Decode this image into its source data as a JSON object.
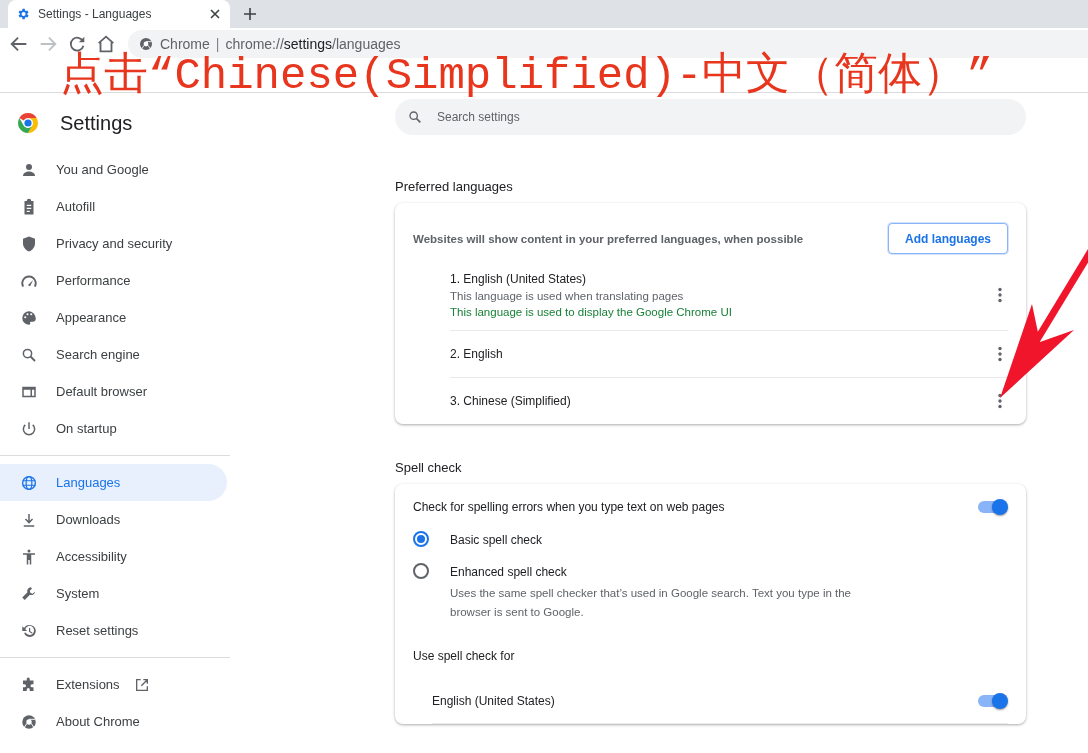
{
  "browser": {
    "tab": {
      "title": "Settings - Languages",
      "selected": true
    },
    "toolbar": {
      "forward_disabled": true,
      "site_label": "Chrome",
      "separator": "|",
      "url": {
        "scheme": "chrome://",
        "host": "settings",
        "path": "/languages"
      }
    }
  },
  "annotation": {
    "text": "点击“Chinese(Simplified)-中文（简体）”"
  },
  "header": {
    "title": "Settings",
    "search": {
      "placeholder": "Search settings"
    }
  },
  "sidebar": {
    "groups": [
      [
        {
          "label": "You and Google",
          "selected": false
        },
        {
          "label": "Autofill",
          "selected": false
        },
        {
          "label": "Privacy and security",
          "selected": false
        },
        {
          "label": "Performance",
          "selected": false
        },
        {
          "label": "Appearance",
          "selected": false
        },
        {
          "label": "Search engine",
          "selected": false
        },
        {
          "label": "Default browser",
          "selected": false
        },
        {
          "label": "On startup",
          "selected": false
        }
      ],
      [
        {
          "label": "Languages",
          "selected": true
        },
        {
          "label": "Downloads",
          "selected": false
        },
        {
          "label": "Accessibility",
          "selected": false
        },
        {
          "label": "System",
          "selected": false
        },
        {
          "label": "Reset settings",
          "selected": false
        }
      ],
      [
        {
          "label": "Extensions",
          "selected": false,
          "external": true
        },
        {
          "label": "About Chrome",
          "selected": false
        }
      ]
    ]
  },
  "preferred_languages": {
    "heading": "Preferred languages",
    "description": "Websites will show content in your preferred languages, when possible",
    "add_button": "Add languages",
    "languages": [
      {
        "name": "1. English (United States)",
        "notes": [
          {
            "text": "This language is used when translating pages",
            "kind": "plain"
          },
          {
            "text": "This language is used to display the Google Chrome UI",
            "kind": "highlight"
          }
        ]
      },
      {
        "name": "2. English"
      },
      {
        "name": "3. Chinese (Simplified)"
      }
    ]
  },
  "spell_check": {
    "heading": "Spell check",
    "toggle": {
      "label": "Check for spelling errors when you type text on web pages",
      "on": true
    },
    "options": [
      {
        "label": "Basic spell check",
        "selected": true
      },
      {
        "label": "Enhanced spell check",
        "selected": false,
        "description": "Uses the same spell checker that’s used in Google search. Text you type in the browser is sent to Google."
      }
    ],
    "use_for": {
      "label": "Use spell check for",
      "languages": [
        {
          "name": "English (United States)",
          "on": true
        }
      ]
    }
  }
}
